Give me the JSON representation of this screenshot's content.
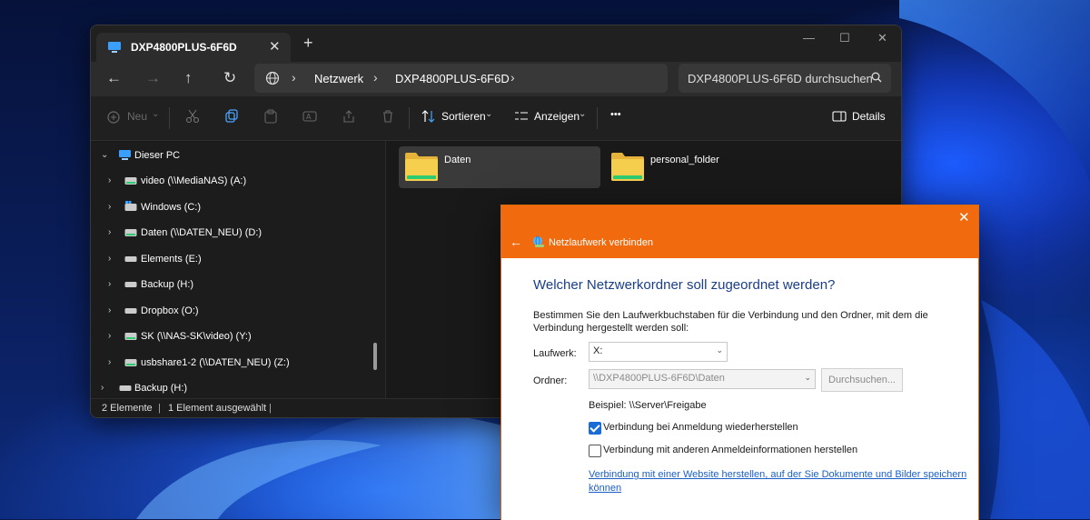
{
  "explorer": {
    "tab_title": "DXP4800PLUS-6F6D",
    "tab_close": "✕",
    "tab_add": "+",
    "window_controls": {
      "minimize": "—",
      "maximize": "☐",
      "close": "✕"
    },
    "nav": {
      "back": "←",
      "forward": "→",
      "up": "↑",
      "refresh": "↻"
    },
    "breadcrumb": [
      "Netzwerk",
      "DXP4800PLUS-6F6D"
    ],
    "breadcrumb_sep": "›",
    "search_placeholder": "DXP4800PLUS-6F6D durchsuchen",
    "toolbar": {
      "new": "Neu",
      "sort": "Sortieren",
      "view": "Anzeigen",
      "more": "•••",
      "details": "Details"
    },
    "sidebar": {
      "root": "Dieser PC",
      "items": [
        "video (\\\\MediaNAS) (A:)",
        "Windows (C:)",
        "Daten (\\\\DATEN_NEU) (D:)",
        "Elements (E:)",
        "Backup (H:)",
        "Dropbox (O:)",
        "SK (\\\\NAS-SK\\video) (Y:)",
        "usbshare1-2 (\\\\DATEN_NEU) (Z:)"
      ],
      "bottom_item": "Backup (H:)"
    },
    "folders": [
      "Daten",
      "personal_folder"
    ],
    "status": {
      "count": "2 Elemente",
      "selected": "1 Element ausgewählt"
    }
  },
  "dialog": {
    "title": "Netzlaufwerk verbinden",
    "close": "✕",
    "back": "←",
    "heading": "Welcher Netzwerkordner soll zugeordnet werden?",
    "description": "Bestimmen Sie den Laufwerkbuchstaben für die Verbindung und den Ordner, mit dem die Verbindung hergestellt werden soll:",
    "drive_label": "Laufwerk:",
    "drive_value": "X:",
    "folder_label": "Ordner:",
    "folder_value": "\\\\DXP4800PLUS-6F6D\\Daten",
    "browse_button": "Durchsuchen...",
    "example": "Beispiel: \\\\Server\\Freigabe",
    "reconnect_label": "Verbindung bei Anmeldung wiederherstellen",
    "reconnect_checked": true,
    "other_credentials_label": "Verbindung mit anderen Anmeldeinformationen herstellen",
    "other_credentials_checked": false,
    "website_link": "Verbindung mit einer Website herstellen, auf der Sie Dokumente und Bilder speichern können"
  }
}
